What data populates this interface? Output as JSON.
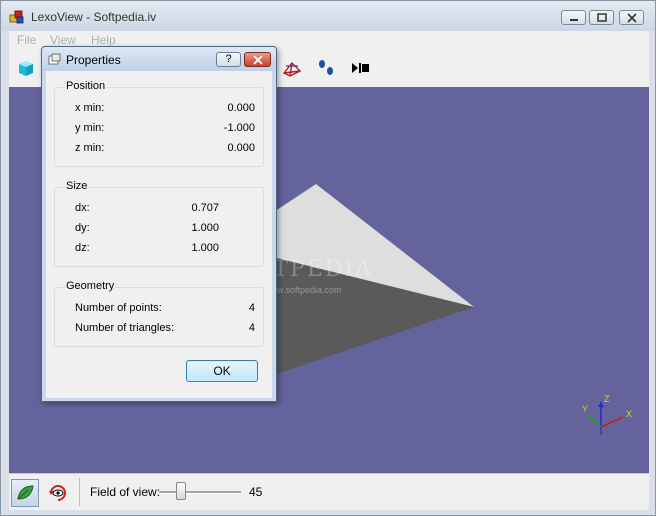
{
  "window": {
    "title": "LexoView - Softpedia.iv"
  },
  "menu": [
    "File",
    "View",
    "Help"
  ],
  "properties": {
    "title": "Properties",
    "help_label": "?",
    "position": {
      "label": "Position",
      "rows": [
        {
          "label": "x min:",
          "value": "0.000"
        },
        {
          "label": "y min:",
          "value": "-1.000"
        },
        {
          "label": "z min:",
          "value": "0.000"
        }
      ]
    },
    "size": {
      "label": "Size",
      "rows": [
        {
          "label": "dx:",
          "value": "0.707"
        },
        {
          "label": "dy:",
          "value": "1.000"
        },
        {
          "label": "dz:",
          "value": "1.000"
        }
      ]
    },
    "geometry": {
      "label": "Geometry",
      "rows": [
        {
          "label": "Number of points:",
          "value": "4"
        },
        {
          "label": "Number of triangles:",
          "value": "4"
        }
      ]
    },
    "ok_label": "OK"
  },
  "bottom": {
    "fov_label": "Field of view:",
    "fov_value": "45"
  },
  "watermark": {
    "text": "SOFTPEDIA",
    "url": "www.softpedia.com"
  },
  "axes": {
    "x": "X",
    "y": "Y",
    "z": "Z"
  },
  "colors": {
    "viewport_bg": "#65639b",
    "mesh_light": "#dedede",
    "mesh_dark": "#5a5a5a"
  }
}
